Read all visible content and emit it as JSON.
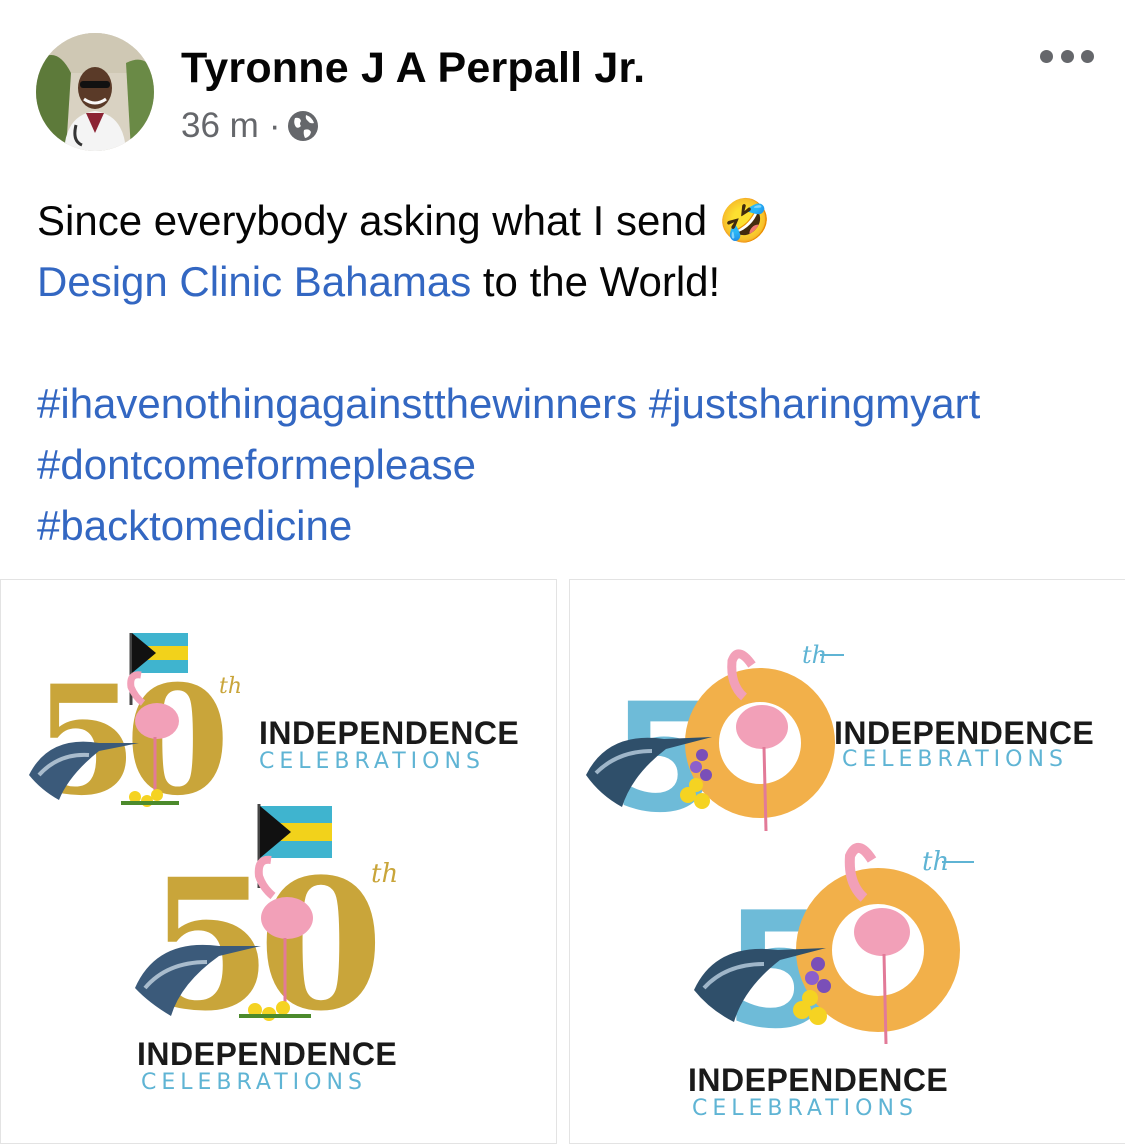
{
  "post": {
    "author": "Tyronne J A Perpall Jr.",
    "time": "36 m",
    "separator": "·",
    "line1": "Since everybody asking what I send",
    "emoji": "🤣",
    "page_link": "Design Clinic Bahamas",
    "line2_rest": " to the World!",
    "hashtags": {
      "h1": "#ihavenothingagainstthewinners",
      "h2": "#justsharingmyart",
      "h3": "#dontcomeformeplease",
      "h4": "#backtomedicine"
    }
  },
  "logos": {
    "number": "50",
    "ordinal": "th",
    "title": "INDEPENDENCE",
    "subtitle": "CELEBRATIONS"
  },
  "colors": {
    "link": "#3367c2",
    "gold": "#c9a53a",
    "blue": "#5fb4d4",
    "orange": "#f2b04a",
    "flamingo": "#f2a0b8"
  }
}
